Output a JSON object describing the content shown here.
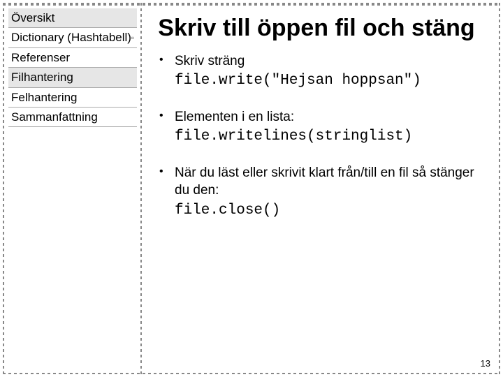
{
  "sidebar": {
    "items": [
      {
        "label": "Översikt",
        "selected": true,
        "expandable": false
      },
      {
        "label": "Dictionary (Hashtabell)",
        "selected": false,
        "expandable": true
      },
      {
        "label": "Referenser",
        "selected": false,
        "expandable": false
      },
      {
        "label": "Filhantering",
        "selected": true,
        "expandable": false
      },
      {
        "label": "Felhantering",
        "selected": false,
        "expandable": false
      },
      {
        "label": "Sammanfattning",
        "selected": false,
        "expandable": false
      }
    ]
  },
  "main": {
    "title": "Skriv till öppen fil och stäng",
    "bullets": [
      {
        "text": "Skriv sträng",
        "code": "file.write(\"Hejsan hoppsan\")"
      },
      {
        "text": "Elementen i en lista:",
        "code": "file.writelines(stringlist)"
      },
      {
        "text": "När du läst eller skrivit klart från/till en fil så stänger du den:",
        "code": "file.close()"
      }
    ]
  },
  "page_number": "13"
}
